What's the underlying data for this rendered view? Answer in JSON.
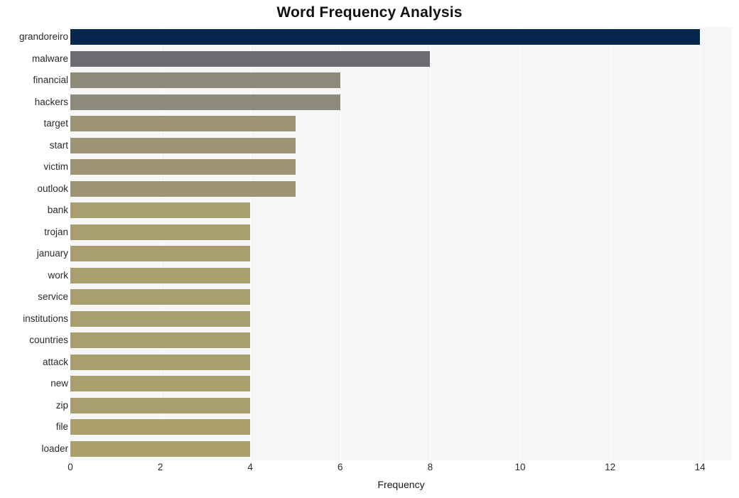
{
  "chart_data": {
    "type": "bar",
    "orientation": "horizontal",
    "title": "Word Frequency Analysis",
    "xlabel": "Frequency",
    "ylabel": "",
    "categories": [
      "grandoreiro",
      "malware",
      "financial",
      "hackers",
      "target",
      "start",
      "victim",
      "outlook",
      "bank",
      "trojan",
      "january",
      "work",
      "service",
      "institutions",
      "countries",
      "attack",
      "new",
      "zip",
      "file",
      "loader"
    ],
    "values": [
      14,
      8,
      6,
      6,
      5,
      5,
      5,
      5,
      4,
      4,
      4,
      4,
      4,
      4,
      4,
      4,
      4,
      4,
      4,
      4
    ],
    "bar_colors": [
      "#06264e",
      "#6b6b72",
      "#8d8a79",
      "#8d8a7c",
      "#9d9573",
      "#9d9573",
      "#9d9573",
      "#9d9573",
      "#a89e6e",
      "#a89e6e",
      "#a89e6e",
      "#a89e6e",
      "#a89e6e",
      "#a89e6e",
      "#a89e6e",
      "#a89e6e",
      "#a89e6e",
      "#a89e6e",
      "#ab9f6b",
      "#ab9f6b"
    ],
    "xticks": [
      0,
      2,
      4,
      6,
      8,
      10,
      12,
      14
    ],
    "xtick_labels": [
      "0",
      "2",
      "4",
      "6",
      "8",
      "10",
      "12",
      "14"
    ],
    "xlim": [
      0,
      14.7
    ],
    "grid": true,
    "grid_axis": "x",
    "grid_color": "#ffffff",
    "plot_background": "#f6f6f7",
    "figure_background": "#ffffff",
    "legend": null
  }
}
